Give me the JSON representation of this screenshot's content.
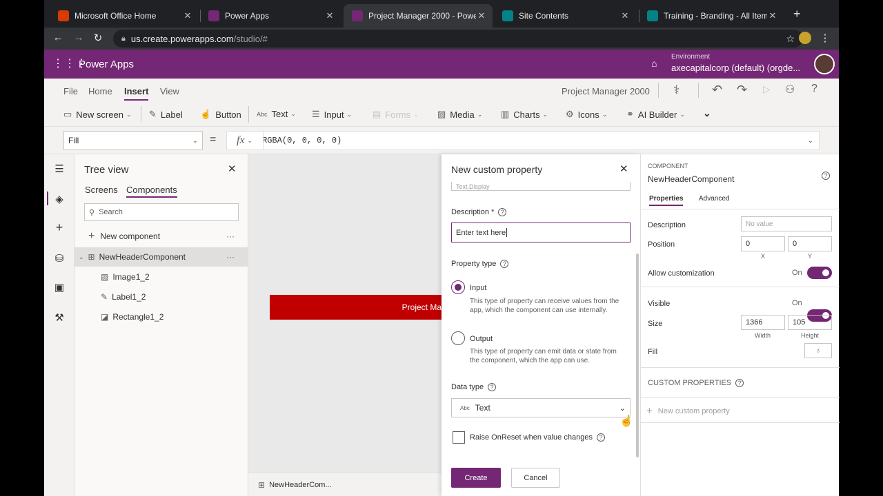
{
  "browser": {
    "tabs": [
      {
        "label": "Microsoft Office Home",
        "icon": "office-icon",
        "color": "#d83b01",
        "active": false
      },
      {
        "label": "Power Apps",
        "icon": "powerapps-icon",
        "color": "#742774",
        "active": false
      },
      {
        "label": "Project Manager 2000 - Powe",
        "icon": "powerapps-icon",
        "color": "#742774",
        "active": true
      },
      {
        "label": "Site Contents",
        "icon": "sharepoint-icon",
        "color": "#038387",
        "active": false
      },
      {
        "label": "Training - Branding - All Items",
        "icon": "sharepoint-icon",
        "color": "#038387",
        "active": false
      }
    ],
    "url_host": "us.create.powerapps.com",
    "url_path": "/studio/#"
  },
  "app_header": {
    "title": "Power Apps",
    "env_label": "Environment",
    "env_value": "axecapitalcorp (default) (orgde..."
  },
  "menu": {
    "items": [
      "File",
      "Home",
      "Insert",
      "View"
    ],
    "active": "Insert",
    "app_name": "Project Manager 2000"
  },
  "toolbar": {
    "items": [
      {
        "label": "New screen",
        "icon": "new-screen-icon",
        "chevron": true,
        "disabled": false
      },
      {
        "label": "Label",
        "icon": "label-icon",
        "chevron": false,
        "disabled": false
      },
      {
        "label": "Button",
        "icon": "button-icon",
        "chevron": false,
        "disabled": false
      },
      {
        "label": "Text",
        "icon": "text-icon",
        "chevron": true,
        "disabled": false
      },
      {
        "label": "Input",
        "icon": "input-icon",
        "chevron": true,
        "disabled": false
      },
      {
        "label": "Forms",
        "icon": "forms-icon",
        "chevron": true,
        "disabled": true
      },
      {
        "label": "Media",
        "icon": "media-icon",
        "chevron": true,
        "disabled": false
      },
      {
        "label": "Charts",
        "icon": "charts-icon",
        "chevron": true,
        "disabled": false
      },
      {
        "label": "Icons",
        "icon": "icons-icon",
        "chevron": true,
        "disabled": false
      },
      {
        "label": "AI Builder",
        "icon": "ai-builder-icon",
        "chevron": true,
        "disabled": false
      }
    ]
  },
  "formula": {
    "property": "Fill",
    "equals": "=",
    "fx": "fx",
    "value": "RGBA(0, 0, 0, 0)"
  },
  "tree": {
    "title": "Tree view",
    "tabs": [
      "Screens",
      "Components"
    ],
    "active_tab": "Components",
    "search_placeholder": "Search",
    "new_component": "New component",
    "component": "NewHeaderComponent",
    "children": [
      "Image1_2",
      "Label1_2",
      "Rectangle1_2"
    ]
  },
  "canvas": {
    "header_text": "Project Ma",
    "header_color": "#c00000",
    "footer_component": "NewHeaderCom..."
  },
  "dialog": {
    "title": "New custom property",
    "display_name_value": "Text.Display",
    "description_label": "Description",
    "required_mark": "*",
    "description_value": "Enter text here",
    "property_type_label": "Property type",
    "options": [
      {
        "label": "Input",
        "desc": "This type of property can receive values from the app, which the component can use internally.",
        "selected": true
      },
      {
        "label": "Output",
        "desc": "This type of property can emit data or state from the component, which the app can use.",
        "selected": false
      }
    ],
    "data_type_label": "Data type",
    "data_type_value": "Text",
    "raise_label": "Raise OnReset when value changes",
    "raise_checked": false,
    "create_label": "Create",
    "cancel_label": "Cancel"
  },
  "properties": {
    "section": "COMPONENT",
    "name": "NewHeaderComponent",
    "tabs": [
      "Properties",
      "Advanced"
    ],
    "active_tab": "Properties",
    "description_label": "Description",
    "description_placeholder": "No value",
    "position_label": "Position",
    "position_x": "0",
    "position_y": "0",
    "x_caption": "X",
    "y_caption": "Y",
    "allow_custom_label": "Allow customization",
    "allow_custom_state": "On",
    "visible_label": "Visible",
    "visible_state": "On",
    "size_label": "Size",
    "width": "1366",
    "height": "105",
    "width_caption": "Width",
    "height_caption": "Height",
    "fill_label": "Fill",
    "custom_props_label": "CUSTOM PROPERTIES",
    "new_custom_prop": "New custom property"
  },
  "colors": {
    "brand": "#742774",
    "chrome_dark": "#202124",
    "canvas_red": "#c00000"
  }
}
